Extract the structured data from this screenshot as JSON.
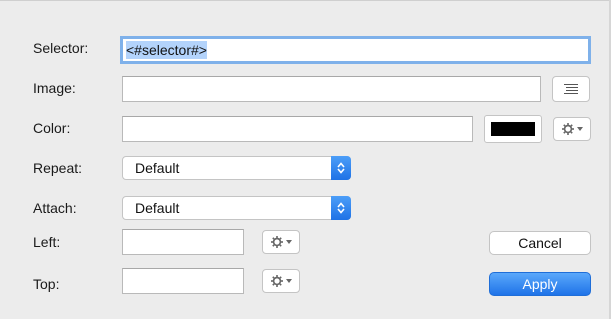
{
  "form": {
    "selector": {
      "label": "Selector:",
      "value": "<#selector#>"
    },
    "image": {
      "label": "Image:",
      "value": "",
      "browse_icon": "list-icon"
    },
    "color": {
      "label": "Color:",
      "value": "",
      "swatch_color": "#000000",
      "action_icon": "gear-icon"
    },
    "repeat": {
      "label": "Repeat:",
      "selected": "Default"
    },
    "attach": {
      "label": "Attach:",
      "selected": "Default"
    },
    "left": {
      "label": "Left:",
      "value": "",
      "action_icon": "gear-icon"
    },
    "top": {
      "label": "Top:",
      "value": "",
      "action_icon": "gear-icon"
    }
  },
  "buttons": {
    "cancel": "Cancel",
    "apply": "Apply"
  },
  "colors": {
    "accent": "#1f73e8",
    "focus_ring": "#7fb1ea",
    "selection": "#b3d3fb",
    "background": "#ececec"
  }
}
